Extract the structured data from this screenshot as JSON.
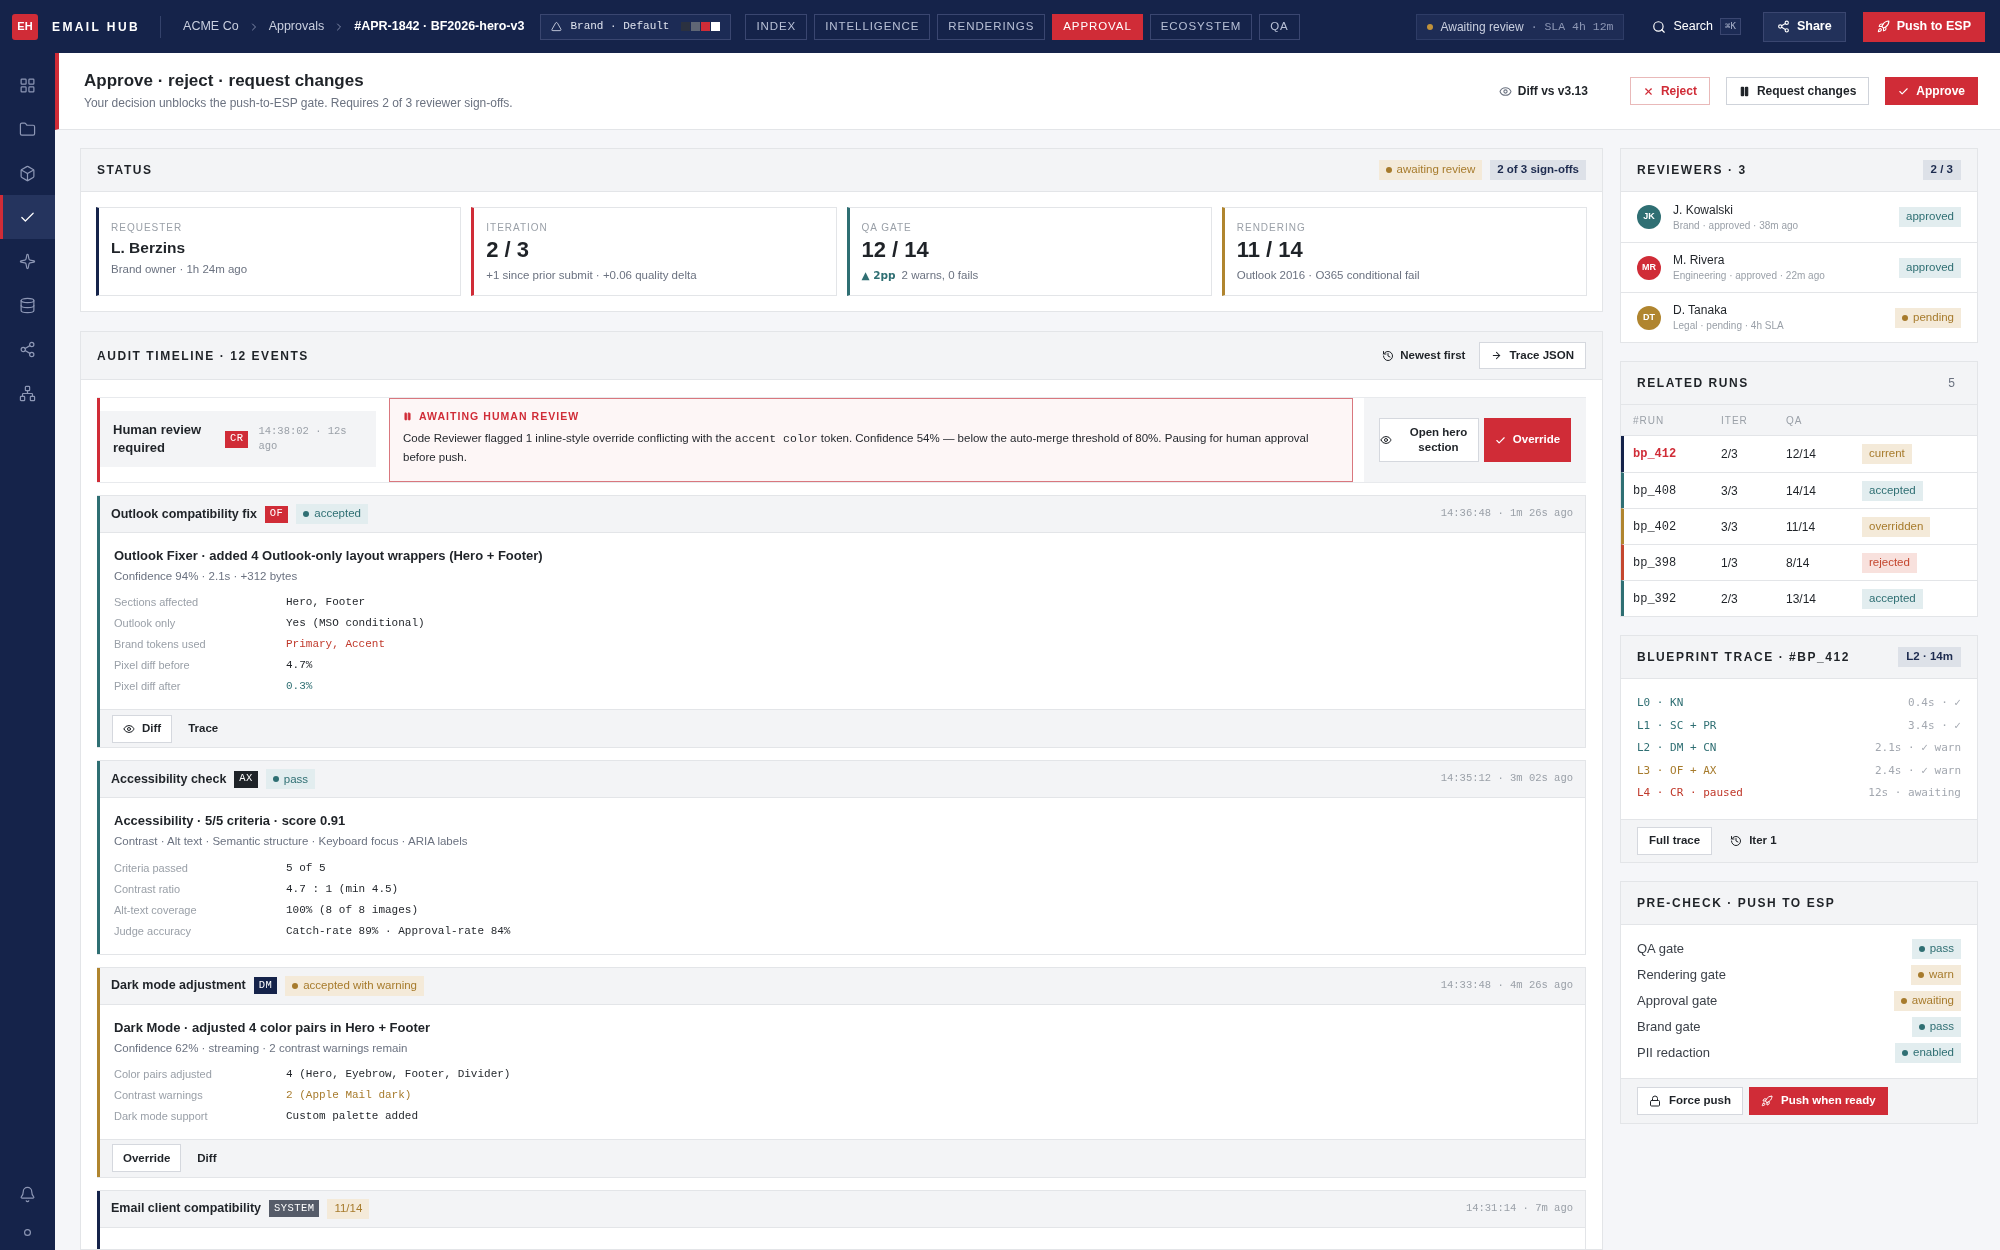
{
  "app": {
    "logo": "EH",
    "name": "EMAIL HUB"
  },
  "breadcrumbs": [
    {
      "label": "ACME Co",
      "current": false
    },
    {
      "label": "Approvals",
      "current": false
    },
    {
      "label": "#APR-1842 · BF2026-hero-v3",
      "current": true
    }
  ],
  "brand_selector": {
    "label": "Brand · Default",
    "swatches": [
      {
        "color": "#2b3140"
      },
      {
        "color": "#5f6675"
      },
      {
        "color": "#d02c37"
      },
      {
        "color": "#ffffff"
      }
    ]
  },
  "nav_tabs": [
    {
      "label": "INDEX",
      "selected": false
    },
    {
      "label": "INTELLIGENCE",
      "selected": false
    },
    {
      "label": "RENDERINGS",
      "selected": false
    },
    {
      "label": "APPROVAL",
      "selected": true
    },
    {
      "label": "ECOSYSTEM",
      "selected": false
    },
    {
      "label": "QA",
      "selected": false
    }
  ],
  "review_status": {
    "label": "Awaiting review",
    "sla": "· SLA 4h 12m"
  },
  "search": {
    "label": "Search",
    "shortcut": "⌘K"
  },
  "top_actions": [
    {
      "label": "Share",
      "kind": "share"
    },
    {
      "label": "Push to ESP",
      "kind": "push"
    }
  ],
  "sidebar": {
    "items": [
      {
        "selected": false
      },
      {
        "selected": false
      },
      {
        "selected": false
      },
      {
        "selected": true
      },
      {
        "selected": false
      },
      {
        "selected": false
      },
      {
        "selected": false
      },
      {
        "selected": false
      }
    ]
  },
  "page_header": {
    "title": "Approve · reject · request changes",
    "subtitle": "Your decision unblocks the push-to-ESP gate. Requires 2 of 3 reviewer sign-offs.",
    "diff_link": "Diff vs v3.13",
    "actions": [
      {
        "label": "Reject",
        "kind": "reject"
      },
      {
        "label": "Request changes",
        "kind": "request"
      },
      {
        "label": "Approve",
        "kind": "approve"
      }
    ]
  },
  "status": {
    "title": "STATUS",
    "badges": [
      {
        "label": "awaiting review",
        "kind": "warning",
        "dot": true
      },
      {
        "label": "2 of 3 sign-offs",
        "kind": "neutral",
        "dot": false
      }
    ],
    "cards": [
      {
        "kind": "person",
        "label": "REQUESTER",
        "value": "L. Berzins",
        "detail": "Brand owner · 1h 24m ago",
        "color": "#15234a"
      },
      {
        "kind": "metric",
        "label": "ITERATION",
        "value": "2 / 3",
        "detail": "+1 since prior submit · +0.06 quality delta",
        "color": "#d02c37"
      },
      {
        "kind": "metric",
        "label": "QA GATE",
        "value": "12 / 14",
        "delta": "▲ 2pp",
        "detail": "2 warns, 0 fails",
        "color": "#2f6f73"
      },
      {
        "kind": "metric",
        "label": "RENDERING",
        "value": "11 / 14",
        "detail": "Outlook 2016 · O365 conditional fail",
        "color": "#b0852f"
      }
    ]
  },
  "audit": {
    "title": "AUDIT TIMELINE · 12 EVENTS",
    "sort": "Newest first",
    "export": "Trace JSON",
    "events": [
      {
        "kind": "review",
        "title": "Human review required",
        "agent": {
          "label": "CR",
          "color": "#d02c37"
        },
        "time": "14:38:02 · 12s ago",
        "color": "#d02c37",
        "alert": {
          "title": "AWAITING HUMAN REVIEW",
          "text": [
            {
              "kind": "plain",
              "text": "Code Reviewer flagged 1 inline-style override conflicting with the"
            },
            {
              "kind": "code",
              "text": "accent color"
            },
            {
              "kind": "plain",
              "text": "token. Confidence 54% — below the auto-merge threshold of 80%. Pausing for human approval before push."
            }
          ]
        },
        "actions": [
          {
            "label": "Open hero section",
            "kind": "view"
          },
          {
            "label": "Override",
            "kind": "primary"
          }
        ]
      },
      {
        "kind": "agent",
        "title": "Outlook compatibility fix",
        "agent": {
          "label": "OF",
          "color": "#d02c37"
        },
        "status": {
          "label": "accepted",
          "kind": "success",
          "dot": true
        },
        "time": "14:36:48 · 1m 26s ago",
        "color": "#2f6f73",
        "summary": "Outlook Fixer · added 4 Outlook-only layout wrappers (Hero + Footer)",
        "meta": "Confidence 94% · 2.1s · +312 bytes",
        "details": [
          {
            "label": "Sections affected",
            "value": "Hero, Footer",
            "kind": "default"
          },
          {
            "label": "Outlook only",
            "value": "Yes (MSO conditional)",
            "kind": "default"
          },
          {
            "label": "Brand tokens used",
            "value": "Primary, Accent",
            "kind": "danger"
          },
          {
            "label": "Pixel diff before",
            "value": "4.7%",
            "kind": "default"
          },
          {
            "label": "Pixel diff after",
            "value": "0.3%",
            "kind": "success"
          }
        ],
        "actions": [
          {
            "label": "Diff",
            "kind": "view"
          },
          {
            "label": "Trace",
            "kind": "plain"
          }
        ]
      },
      {
        "kind": "agent",
        "title": "Accessibility check",
        "agent": {
          "label": "AX",
          "color": "#1f2328"
        },
        "status": {
          "label": "pass",
          "kind": "success",
          "dot": true
        },
        "time": "14:35:12 · 3m 02s ago",
        "color": "#2f6f73",
        "summary": "Accessibility · 5/5 criteria · score 0.91",
        "meta": "Contrast · Alt text · Semantic structure · Keyboard focus · ARIA labels",
        "details": [
          {
            "label": "Criteria passed",
            "value": "5 of 5",
            "kind": "default"
          },
          {
            "label": "Contrast ratio",
            "value": "4.7 : 1 (min 4.5)",
            "kind": "default"
          },
          {
            "label": "Alt-text coverage",
            "value": "100% (8 of 8 images)",
            "kind": "default"
          },
          {
            "label": "Judge accuracy",
            "value": "Catch-rate 89% · Approval-rate 84%",
            "kind": "default"
          }
        ]
      },
      {
        "kind": "agent",
        "title": "Dark mode adjustment",
        "agent": {
          "label": "DM",
          "color": "#15234a"
        },
        "status": {
          "label": "accepted with warning",
          "kind": "warning",
          "dot": true
        },
        "time": "14:33:48 · 4m 26s ago",
        "color": "#b0852f",
        "summary": "Dark Mode · adjusted 4 color pairs in Hero + Footer",
        "meta": "Confidence 62% · streaming · 2 contrast warnings remain",
        "details": [
          {
            "label": "Color pairs adjusted",
            "value": "4 (Hero, Eyebrow, Footer, Divider)",
            "kind": "default"
          },
          {
            "label": "Contrast warnings",
            "value": "2 (Apple Mail dark)",
            "kind": "warning"
          },
          {
            "label": "Dark mode support",
            "value": "Custom palette added",
            "kind": "default"
          }
        ],
        "actions": [
          {
            "label": "Override",
            "kind": "outlined"
          },
          {
            "label": "Diff",
            "kind": "plain"
          }
        ]
      },
      {
        "kind": "system",
        "title": "Email client compatibility",
        "agent": {
          "label": "SYSTEM",
          "color": "#565c69"
        },
        "status": {
          "label": "11/14",
          "kind": "warning",
          "dot": false
        },
        "time": "14:31:14 · 7m ago",
        "color": "#15234a"
      }
    ]
  },
  "reviewers": {
    "title": "REVIEWERS · 3",
    "count": "2 / 3",
    "items": [
      {
        "initials": "JK",
        "name": "J. Kowalski",
        "detail": "Brand · approved · 38m ago",
        "status": {
          "label": "approved",
          "kind": "success",
          "dot": false
        },
        "color": "#2f6f73"
      },
      {
        "initials": "MR",
        "name": "M. Rivera",
        "detail": "Engineering · approved · 22m ago",
        "status": {
          "label": "approved",
          "kind": "success",
          "dot": false
        },
        "color": "#d02c37"
      },
      {
        "initials": "DT",
        "name": "D. Tanaka",
        "detail": "Legal · pending · 4h SLA",
        "status": {
          "label": "pending",
          "kind": "warning",
          "dot": true
        },
        "color": "#b0852f"
      }
    ]
  },
  "related_runs": {
    "title": "RELATED RUNS",
    "count": "5",
    "columns": [
      "#RUN",
      "ITER",
      "QA"
    ],
    "rows": [
      {
        "run": "bp_412",
        "iter": "2/3",
        "qa": "12/14",
        "status": {
          "label": "current",
          "kind": "warning",
          "dot": false
        },
        "color": "#15234a",
        "selected": true
      },
      {
        "run": "bp_408",
        "iter": "3/3",
        "qa": "14/14",
        "status": {
          "label": "accepted",
          "kind": "success",
          "dot": false
        },
        "color": "#2f6f73",
        "selected": false
      },
      {
        "run": "bp_402",
        "iter": "3/3",
        "qa": "11/14",
        "status": {
          "label": "overridden",
          "kind": "warning",
          "dot": false
        },
        "color": "#b0852f",
        "selected": false
      },
      {
        "run": "bp_398",
        "iter": "1/3",
        "qa": "8/14",
        "status": {
          "label": "rejected",
          "kind": "danger",
          "dot": false
        },
        "color": "#c4472f",
        "selected": false
      },
      {
        "run": "bp_392",
        "iter": "2/3",
        "qa": "13/14",
        "status": {
          "label": "accepted",
          "kind": "success",
          "dot": false
        },
        "color": "#2f6f73",
        "selected": false
      }
    ]
  },
  "blueprint_trace": {
    "title": "BLUEPRINT TRACE · #BP_412",
    "badge": "L2 · 14m",
    "rows": [
      {
        "label": "L0 · KN",
        "result": "0.4s · ✓",
        "kind": "success"
      },
      {
        "label": "L1 · SC + PR",
        "result": "3.4s · ✓",
        "kind": "success"
      },
      {
        "label": "L2 · DM + CN",
        "result": "2.1s · ✓ warn",
        "kind": "success"
      },
      {
        "label": "L3 · OF + AX",
        "result": "2.4s · ✓ warn",
        "kind": "warning"
      },
      {
        "label": "L4 · CR · paused",
        "result": "12s · awaiting",
        "kind": "danger"
      }
    ],
    "actions": [
      {
        "label": "Full trace",
        "kind": "outlined"
      },
      {
        "label": "Iter 1",
        "kind": "history"
      }
    ]
  },
  "precheck": {
    "title": "PRE-CHECK · PUSH TO ESP",
    "rows": [
      {
        "label": "QA gate",
        "status": {
          "label": "pass",
          "kind": "success",
          "dot": true
        }
      },
      {
        "label": "Rendering gate",
        "status": {
          "label": "warn",
          "kind": "warning",
          "dot": true
        }
      },
      {
        "label": "Approval gate",
        "status": {
          "label": "awaiting",
          "kind": "warning",
          "dot": true
        }
      },
      {
        "label": "Brand gate",
        "status": {
          "label": "pass",
          "kind": "success",
          "dot": true
        }
      },
      {
        "label": "PII redaction",
        "status": {
          "label": "enabled",
          "kind": "success",
          "dot": true
        }
      }
    ],
    "actions": [
      {
        "label": "Force push",
        "kind": "lock"
      },
      {
        "label": "Push when ready",
        "kind": "primary"
      }
    ]
  }
}
